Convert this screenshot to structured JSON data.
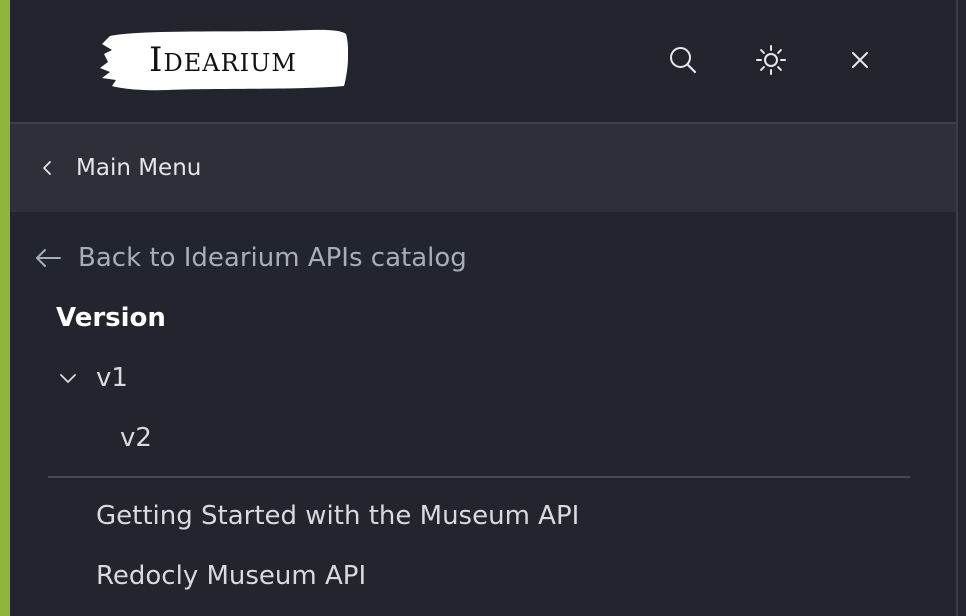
{
  "colors": {
    "accent_bar": "#8fb63b",
    "background": "#22252d",
    "submenu_background": "#2d3038"
  },
  "header": {
    "logo_text": "Idearium",
    "icons": [
      "search-icon",
      "sun-icon",
      "close-icon"
    ]
  },
  "submenu": {
    "icon": "chevron-left-icon",
    "label": "Main Menu"
  },
  "back_link": {
    "icon": "arrow-left-icon",
    "label": "Back to Idearium APIs catalog"
  },
  "version": {
    "title": "Version",
    "items": [
      {
        "label": "v1",
        "expanded": true,
        "icon": "chevron-down-icon"
      },
      {
        "label": "v2"
      }
    ]
  },
  "nav": {
    "items": [
      {
        "label": "Getting Started with the Museum API"
      },
      {
        "label": "Redocly Museum API"
      }
    ]
  }
}
